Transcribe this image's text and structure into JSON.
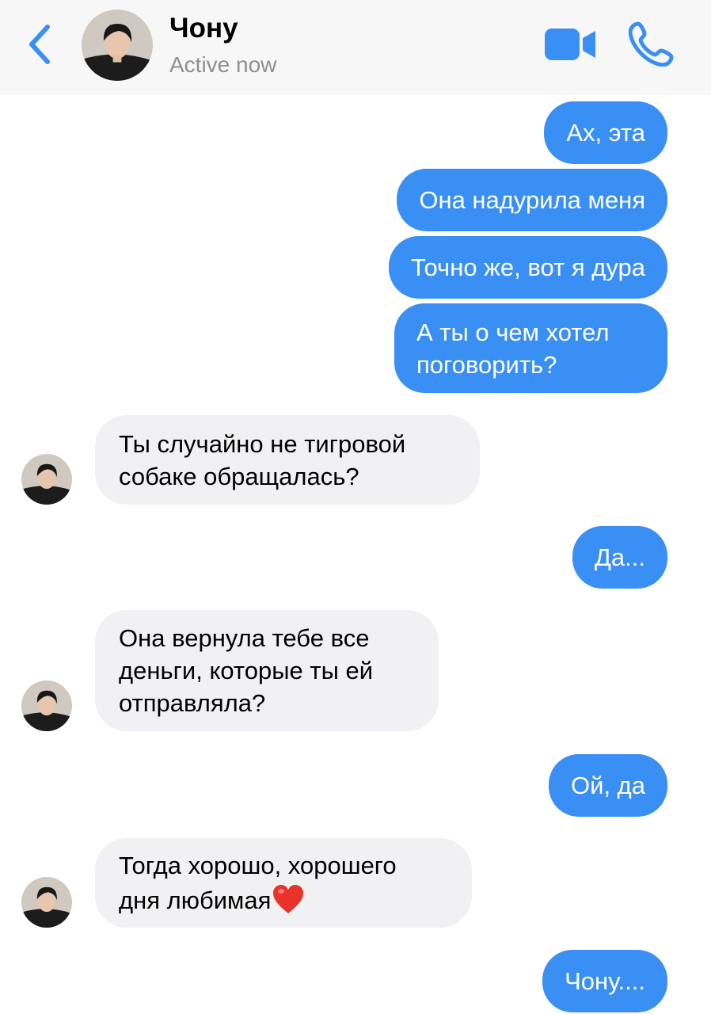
{
  "header": {
    "contact_name": "Чону",
    "status": "Active now",
    "back_icon": "chevron-left-icon",
    "video_icon": "video-camera-icon",
    "phone_icon": "phone-icon",
    "accent_color": "#3a8ff5"
  },
  "messages": [
    {
      "direction": "out",
      "text": "Ах, эта"
    },
    {
      "direction": "out",
      "text": "Она надурила меня"
    },
    {
      "direction": "out",
      "text": "Точно же, вот я дура"
    },
    {
      "direction": "out",
      "text": "А ты о чем хотел\nпоговорить?"
    },
    {
      "direction": "in",
      "text": "Ты случайно не тигровой\nсобаке обращалась?"
    },
    {
      "direction": "out",
      "text": "Да..."
    },
    {
      "direction": "in",
      "text": "Она вернула тебе все\nденьги, которые ты ей\nотправляла?"
    },
    {
      "direction": "out",
      "text": "Ой, да"
    },
    {
      "direction": "in",
      "text": "Тогда хорошо, хорошего\nдня любимая",
      "emoji": "red-heart-icon"
    },
    {
      "direction": "out",
      "text": "Чону...."
    }
  ],
  "colors": {
    "outgoing_bubble": "#3a8ff5",
    "incoming_bubble": "#f1f1f3",
    "header_bg": "#f7f7f8"
  }
}
